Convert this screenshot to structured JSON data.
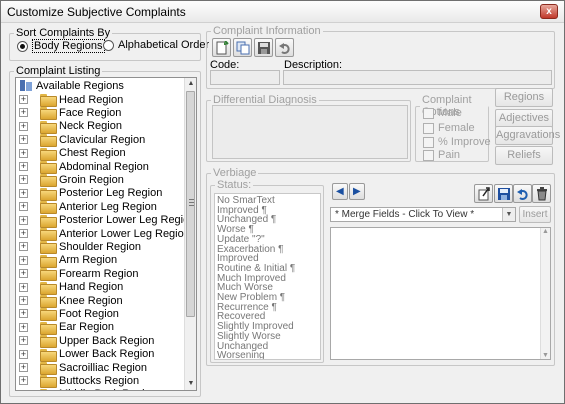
{
  "window": {
    "title": "Customize Subjective Complaints",
    "close_glyph": "x"
  },
  "sort_group": {
    "legend": "Sort Complaints By",
    "options": [
      {
        "label": "Body Regions",
        "selected": true
      },
      {
        "label": "Alphabetical Order",
        "selected": false
      }
    ]
  },
  "listing": {
    "legend": "Complaint Listing",
    "root": "Available Regions",
    "expander_glyph": "+",
    "items": [
      "Head Region",
      "Face Region",
      "Neck Region",
      "Clavicular Region",
      "Chest Region",
      "Abdominal Region",
      "Groin Region",
      "Posterior Leg Region",
      "Anterior Leg Region",
      "Posterior Lower Leg Region",
      "Anterior Lower Leg Region",
      "Shoulder Region",
      "Arm Region",
      "Forearm Region",
      "Hand Region",
      "Knee Region",
      "Foot Region",
      "Ear Region",
      "Upper Back Region",
      "Lower Back Region",
      "Sacroilliac Region",
      "Buttocks Region",
      "Middle Back Region"
    ]
  },
  "info": {
    "legend": "Complaint Information",
    "code_label": "Code:",
    "description_label": "Description:"
  },
  "diff": {
    "legend": "Differential Diagnosis"
  },
  "options": {
    "legend": "Complaint Options",
    "items": [
      "Male",
      "Female",
      "% Improve",
      "Pain"
    ]
  },
  "side_buttons": [
    "Regions",
    "Adjectives",
    "Aggravations",
    "Reliefs"
  ],
  "verbiage": {
    "legend": "Verbiage",
    "status_legend": "Status:",
    "status_items": [
      "No SmarText",
      "Improved ¶",
      "Unchanged ¶",
      "Worse ¶",
      "Update \"?\"",
      "Exacerbation ¶",
      "Improved",
      "Routine & Initial ¶",
      "Much Improved",
      "Much Worse",
      "New Problem ¶",
      "Recurrence ¶",
      "Recovered",
      "Slightly Improved",
      "Slightly Worse",
      "Unchanged",
      "Worsening"
    ],
    "merge_placeholder": "* Merge Fields - Click To View *",
    "insert_label": "Insert"
  },
  "icons": {
    "prev": "◀",
    "next": "▶",
    "scroll_up": "▲",
    "scroll_down": "▼"
  }
}
